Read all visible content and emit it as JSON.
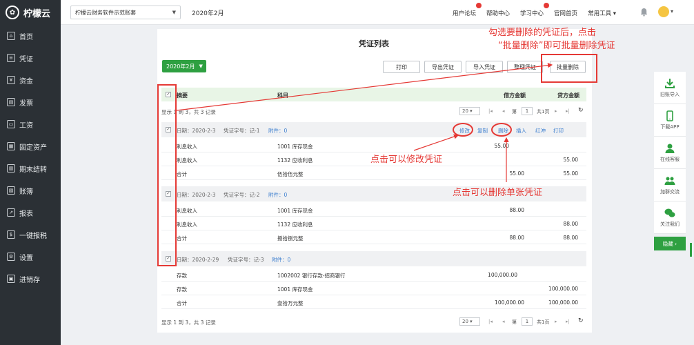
{
  "app": {
    "name": "柠檬云"
  },
  "nav": [
    {
      "label": "首页",
      "icon": "home-icon",
      "glyph": "⌂"
    },
    {
      "label": "凭证",
      "icon": "voucher-icon",
      "glyph": "≡"
    },
    {
      "label": "资金",
      "icon": "cash-icon",
      "glyph": "¥"
    },
    {
      "label": "发票",
      "icon": "invoice-icon",
      "glyph": "▤"
    },
    {
      "label": "工资",
      "icon": "wage-icon",
      "glyph": "▭"
    },
    {
      "label": "固定资产",
      "icon": "asset-icon",
      "glyph": "▦"
    },
    {
      "label": "期末结转",
      "icon": "calendar-icon",
      "glyph": "▥"
    },
    {
      "label": "账簿",
      "icon": "book-icon",
      "glyph": "▧"
    },
    {
      "label": "报表",
      "icon": "report-icon",
      "glyph": "↗"
    },
    {
      "label": "一键报税",
      "icon": "tax-icon",
      "glyph": "$"
    },
    {
      "label": "设置",
      "icon": "gear-icon",
      "glyph": "⚙"
    },
    {
      "label": "进销存",
      "icon": "inventory-icon",
      "glyph": "▣"
    }
  ],
  "topbar": {
    "account": "柠檬云财务软件示范账套",
    "period": "2020年2月",
    "links": [
      "用户论坛",
      "帮助中心",
      "学习中心",
      "官网首页",
      "常用工具"
    ]
  },
  "page": {
    "title": "凭证列表",
    "period_btn": "2020年2月",
    "buttons": [
      "打印",
      "导出凭证",
      "导入凭证",
      "整理凭证",
      "批量删除"
    ]
  },
  "table": {
    "headers": {
      "summary": "摘要",
      "subject": "科目",
      "debit": "借方金额",
      "credit": "贷方金额"
    },
    "pager": {
      "info": "显示 1 到 3，共 3 记录",
      "size": "20",
      "page_prefix": "第",
      "page": "1",
      "page_suffix": "共1页"
    },
    "vouchers": [
      {
        "date": "日期：2020-2-3",
        "code": "凭证字号：记-1",
        "attach": "附件：0",
        "actions": [
          "修改",
          "复制",
          "删除",
          "插入",
          "红冲",
          "打印"
        ],
        "rows": [
          {
            "summary": "利息收入",
            "subject": "1001 库存现金",
            "debit": "55.00",
            "credit": ""
          },
          {
            "summary": "利息收入",
            "subject": "1132 应收利息",
            "debit": "",
            "credit": "55.00"
          },
          {
            "summary": "合计",
            "subject": "伍拾伍元整",
            "debit": "55.00",
            "credit": "55.00"
          }
        ]
      },
      {
        "date": "日期：2020-2-3",
        "code": "凭证字号：记-2",
        "attach": "附件：0",
        "rows": [
          {
            "summary": "利息收入",
            "subject": "1001 库存现金",
            "debit": "88.00",
            "credit": ""
          },
          {
            "summary": "利息收入",
            "subject": "1132 应收利息",
            "debit": "",
            "credit": "88.00"
          },
          {
            "summary": "合计",
            "subject": "捌拾捌元整",
            "debit": "88.00",
            "credit": "88.00"
          }
        ]
      },
      {
        "date": "日期：2020-2-29",
        "code": "凭证字号：记-3",
        "attach": "附件：0",
        "rows": [
          {
            "summary": "存款",
            "subject": "1002002 银行存款-招商银行",
            "debit": "100,000.00",
            "credit": ""
          },
          {
            "summary": "存款",
            "subject": "1001 库存现金",
            "debit": "",
            "credit": "100,000.00"
          },
          {
            "summary": "合计",
            "subject": "壹拾万元整",
            "debit": "100,000.00",
            "credit": "100,000.00"
          }
        ]
      }
    ]
  },
  "annotations": {
    "top_line1": "勾选要删除的凭证后，点击",
    "top_line2": "“批量删除”即可批量删除凭证",
    "edit": "点击可以修改凭证",
    "delete": "点击可以删除单张凭证"
  },
  "right_bar": {
    "items": [
      "旧账导入",
      "下载APP",
      "在线客服",
      "加群交流",
      "关注我们"
    ],
    "hide": "隐藏 ›"
  },
  "colors": {
    "sidebar": "#2b3035",
    "accent": "#2ea041",
    "annotation": "#e53935",
    "link": "#3d7fcf"
  }
}
